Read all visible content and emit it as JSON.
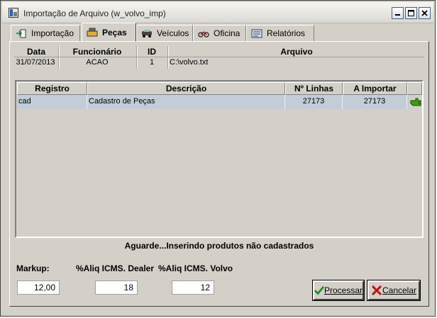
{
  "window": {
    "title": "Importação de Arquivo (w_volvo_imp)"
  },
  "tabs": [
    {
      "label": "Importação",
      "icon": "import-icon"
    },
    {
      "label": "Peças",
      "icon": "parts-icon"
    },
    {
      "label": "Veículos",
      "icon": "vehicle-icon"
    },
    {
      "label": "Oficina",
      "icon": "workshop-icon"
    },
    {
      "label": "Relatórios",
      "icon": "reports-icon"
    }
  ],
  "header": {
    "columns": [
      "Data",
      "Funcionário",
      "ID",
      "Arquivo"
    ],
    "values": [
      "31/07/2013",
      "ACAO",
      "1",
      "C:\\volvo.txt"
    ]
  },
  "table": {
    "columns": [
      "Registro",
      "Descrição",
      "Nº Linhas",
      "A Importar"
    ],
    "rows": [
      {
        "registro": "cad",
        "descricao": "Cadastro de Peças",
        "linhas": "27173",
        "importar": "27173"
      }
    ]
  },
  "status": "Aguarde...Inserindo produtos não cadastrados",
  "fields": {
    "markup": {
      "label": "Markup:",
      "value": "12,00"
    },
    "icms_dealer": {
      "label": "%Aliq ICMS. Dealer",
      "value": "18"
    },
    "icms_volvo": {
      "label": "%Aliq ICMS. Volvo",
      "value": "12"
    }
  },
  "buttons": {
    "processar": "Processar",
    "cancelar": "Cancelar"
  },
  "colors": {
    "face": "#d4d0c8",
    "row_selected": "#c2cdd9",
    "hand_green": "#3aa010"
  }
}
